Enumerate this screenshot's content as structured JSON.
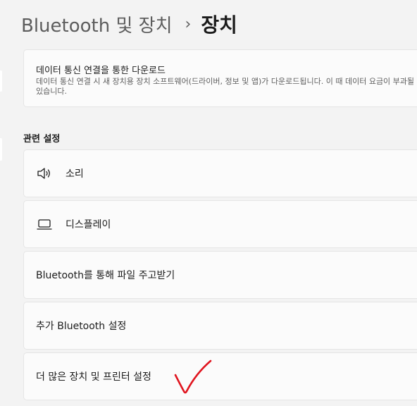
{
  "header": {
    "parent": "Bluetooth 및 장치",
    "separator": "›",
    "current": "장치"
  },
  "download_card": {
    "title": "데이터 통신 연결을 통한 다운로드",
    "description": "데이터 통신 연결 시 새 장치용 장치 소프트웨어(드라이버, 정보 및 앱)가 다운로드됩니다. 이 때 데이터 요금이 부과될 수 있습니다."
  },
  "related": {
    "title": "관련 설정",
    "items": [
      {
        "label": "소리",
        "icon": "speaker-icon"
      },
      {
        "label": "디스플레이",
        "icon": "laptop-icon"
      },
      {
        "label": "Bluetooth를 통해 파일 주고받기"
      },
      {
        "label": "추가 Bluetooth 설정"
      },
      {
        "label": "더 많은 장치 및 프린터 설정"
      }
    ]
  },
  "annotation": {
    "checkmark_color": "#e0141e"
  }
}
